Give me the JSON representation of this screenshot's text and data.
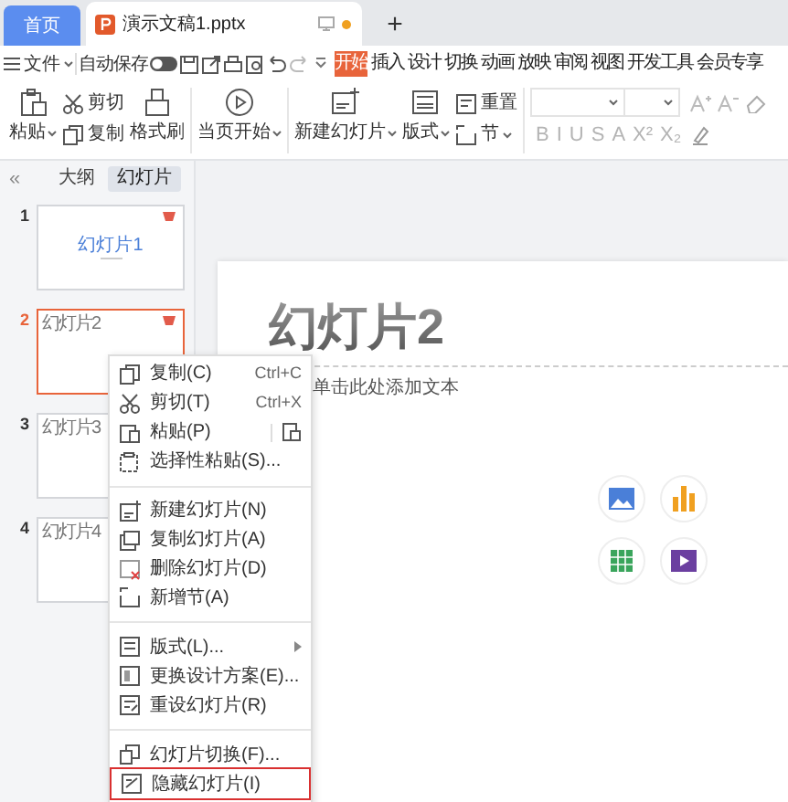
{
  "tabs": [
    {
      "label": "首页",
      "kind": "home",
      "selected": false
    },
    {
      "label": "演示文稿1.pptx",
      "kind": "document",
      "selected": true
    }
  ],
  "new_tab": "+",
  "quick_bar": {
    "file_menu": "文件",
    "autosave_label": "自动保存",
    "autosave_on": false
  },
  "ribbon_tabs": [
    {
      "label": "开始",
      "selected": true
    },
    {
      "label": "插入",
      "selected": false
    },
    {
      "label": "设计",
      "selected": false
    },
    {
      "label": "切换",
      "selected": false
    },
    {
      "label": "动画",
      "selected": false
    },
    {
      "label": "放映",
      "selected": false
    },
    {
      "label": "审阅",
      "selected": false
    },
    {
      "label": "视图",
      "selected": false
    },
    {
      "label": "开发工具",
      "selected": false
    },
    {
      "label": "会员专享",
      "selected": false
    }
  ],
  "ribbon": {
    "paste": "粘贴",
    "cut": "剪切",
    "copy": "复制",
    "format_painter": "格式刷",
    "play_current": "当页开始",
    "new_slide": "新建幻灯片",
    "layout": "版式",
    "reset": "重置",
    "section": "节",
    "font_buttons": [
      "B",
      "I",
      "U",
      "S",
      "A",
      "X²",
      "X₂"
    ]
  },
  "panel": {
    "collapse": "«",
    "tabs": [
      {
        "label": "大纲",
        "selected": false
      },
      {
        "label": "幻灯片",
        "selected": true
      }
    ],
    "slides": [
      {
        "number": "1",
        "kind": "title",
        "title": "幻灯片1",
        "selected": false
      },
      {
        "number": "2",
        "kind": "content",
        "title": "幻灯片2",
        "selected": true
      },
      {
        "number": "3",
        "kind": "content",
        "title": "幻灯片3",
        "selected": false
      },
      {
        "number": "4",
        "kind": "content",
        "title": "幻灯片4",
        "selected": false
      }
    ]
  },
  "slide": {
    "title": "幻灯片2",
    "placeholder": "单击此处添加文本"
  },
  "context_menu": [
    {
      "kind": "item",
      "label": "复制(C)",
      "shortcut": "Ctrl+C",
      "highlighted": false
    },
    {
      "kind": "item",
      "label": "剪切(T)",
      "shortcut": "Ctrl+X",
      "highlighted": false
    },
    {
      "kind": "paste",
      "label": "粘贴(P)",
      "highlighted": false
    },
    {
      "kind": "item",
      "label": "选择性粘贴(S)...",
      "highlighted": false
    },
    {
      "kind": "separator"
    },
    {
      "kind": "item",
      "label": "新建幻灯片(N)",
      "highlighted": false
    },
    {
      "kind": "item",
      "label": "复制幻灯片(A)",
      "highlighted": false
    },
    {
      "kind": "item",
      "label": "删除幻灯片(D)",
      "highlighted": false
    },
    {
      "kind": "item",
      "label": "新增节(A)",
      "highlighted": false
    },
    {
      "kind": "separator"
    },
    {
      "kind": "submenu",
      "label": "版式(L)...",
      "highlighted": false
    },
    {
      "kind": "item",
      "label": "更换设计方案(E)...",
      "highlighted": false
    },
    {
      "kind": "item",
      "label": "重设幻灯片(R)",
      "highlighted": false
    },
    {
      "kind": "separator"
    },
    {
      "kind": "item",
      "label": "幻灯片切换(F)...",
      "highlighted": false
    },
    {
      "kind": "item",
      "label": "隐藏幻灯片(I)",
      "highlighted": true
    }
  ]
}
